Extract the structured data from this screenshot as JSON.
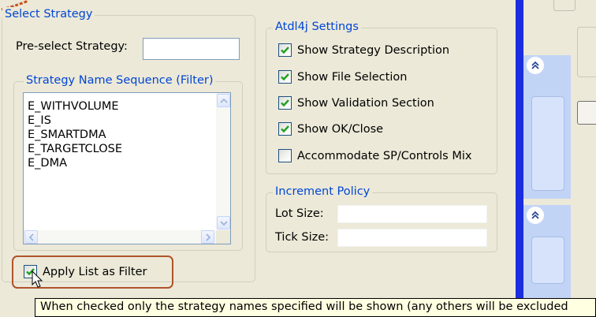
{
  "select_strategy": {
    "title": "Select Strategy",
    "preselect_label": "Pre-select Strategy:",
    "preselect_value": ""
  },
  "name_sequence": {
    "title": "Strategy Name Sequence (Filter)",
    "items": [
      "E_WITHVOLUME",
      "E_IS",
      "E_SMARTDMA",
      "E_TARGETCLOSE",
      "E_DMA"
    ],
    "apply_label": "Apply List as Filter",
    "apply_checked": true
  },
  "atdl4j_settings": {
    "title": "Atdl4j Settings",
    "options": [
      {
        "label": "Show Strategy Description",
        "checked": true
      },
      {
        "label": "Show File Selection",
        "checked": true
      },
      {
        "label": "Show Validation Section",
        "checked": true
      },
      {
        "label": "Show OK/Close",
        "checked": true
      },
      {
        "label": "Accommodate SP/Controls Mix",
        "checked": false
      }
    ]
  },
  "increment_policy": {
    "title": "Increment Policy",
    "lot_size_label": "Lot Size:",
    "lot_size_value": "",
    "tick_size_label": "Tick Size:",
    "tick_size_value": ""
  },
  "tooltip": {
    "text": "When checked only the strategy names specified will be shown (any others will be excluded"
  },
  "colors": {
    "dialog_bg": "#ece9d8",
    "group_title": "#0046d5",
    "highlight_border": "#b0532c",
    "checkmark": "#21a121",
    "tooltip_bg": "#ffffe1",
    "side_panel_blue": "#c2d4f6"
  }
}
